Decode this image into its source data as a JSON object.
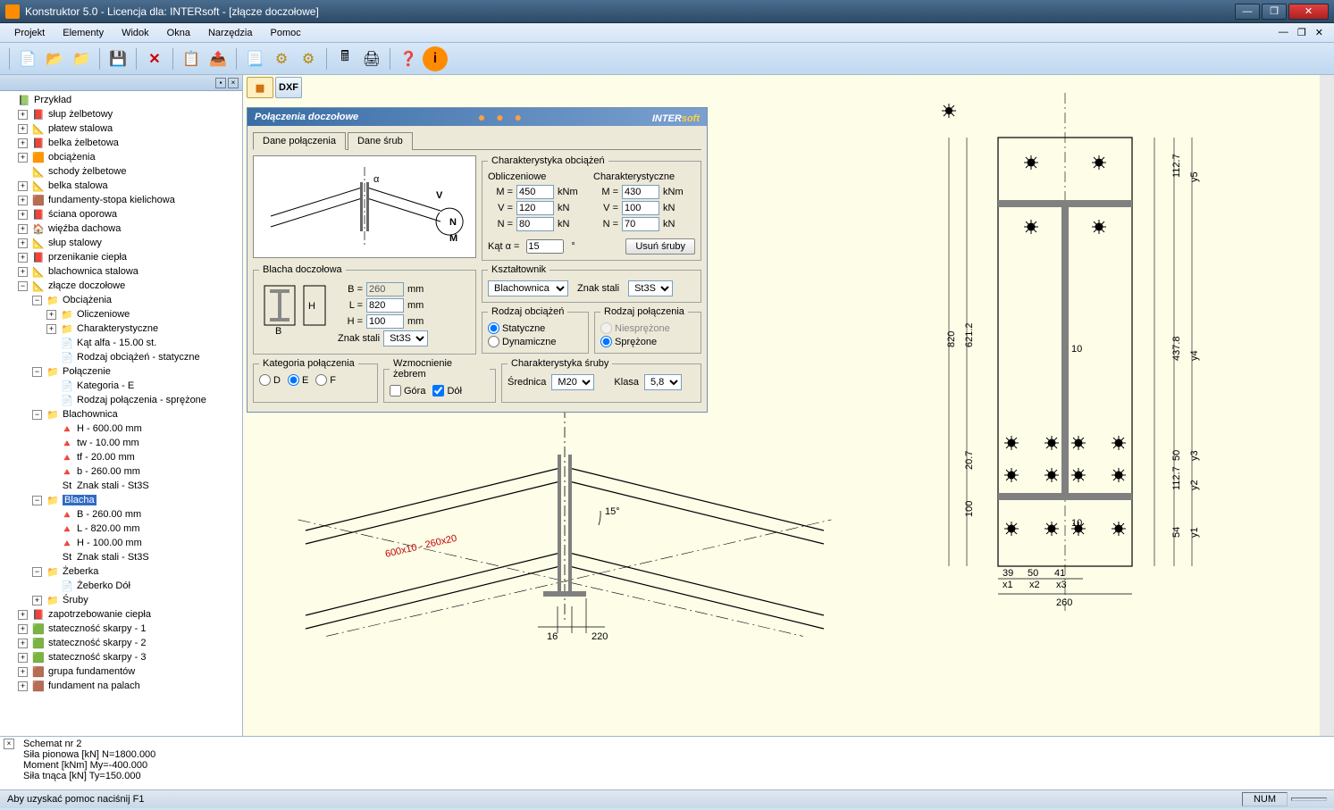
{
  "window": {
    "title": "Konstruktor 5.0 - Licencja dla: INTERsoft - [złącze doczołowe]"
  },
  "menus": [
    "Projekt",
    "Elementy",
    "Widok",
    "Okna",
    "Narzędzia",
    "Pomoc"
  ],
  "tree": {
    "root": "Przykład",
    "items": [
      {
        "d": 1,
        "exp": "+",
        "icon": "📕",
        "label": "słup żelbetowy"
      },
      {
        "d": 1,
        "exp": "+",
        "icon": "📐",
        "label": "płatew stalowa"
      },
      {
        "d": 1,
        "exp": "+",
        "icon": "📕",
        "label": "belka żelbetowa"
      },
      {
        "d": 1,
        "exp": "+",
        "icon": "🟧",
        "label": "obciążenia"
      },
      {
        "d": 1,
        "exp": "",
        "icon": "📐",
        "label": "schody żelbetowe"
      },
      {
        "d": 1,
        "exp": "+",
        "icon": "📐",
        "label": "belka stalowa"
      },
      {
        "d": 1,
        "exp": "+",
        "icon": "🟫",
        "label": "fundamenty-stopa kielichowa"
      },
      {
        "d": 1,
        "exp": "+",
        "icon": "📕",
        "label": "ściana oporowa"
      },
      {
        "d": 1,
        "exp": "+",
        "icon": "🏠",
        "label": "więźba dachowa"
      },
      {
        "d": 1,
        "exp": "+",
        "icon": "📐",
        "label": "słup stalowy"
      },
      {
        "d": 1,
        "exp": "+",
        "icon": "📕",
        "label": "przenikanie ciepła"
      },
      {
        "d": 1,
        "exp": "+",
        "icon": "📐",
        "label": "blachownica stalowa"
      },
      {
        "d": 1,
        "exp": "−",
        "icon": "📐",
        "label": "złącze doczołowe"
      },
      {
        "d": 2,
        "exp": "−",
        "icon": "📁",
        "label": "Obciążenia"
      },
      {
        "d": 3,
        "exp": "+",
        "icon": "📁",
        "label": "Oliczeniowe"
      },
      {
        "d": 3,
        "exp": "+",
        "icon": "📁",
        "label": "Charakterystyczne"
      },
      {
        "d": 3,
        "exp": "",
        "icon": "📄",
        "label": "Kąt alfa - 15.00 st."
      },
      {
        "d": 3,
        "exp": "",
        "icon": "📄",
        "label": "Rodzaj obciążeń - statyczne"
      },
      {
        "d": 2,
        "exp": "−",
        "icon": "📁",
        "label": "Połączenie"
      },
      {
        "d": 3,
        "exp": "",
        "icon": "📄",
        "label": "Kategoria - E"
      },
      {
        "d": 3,
        "exp": "",
        "icon": "📄",
        "label": "Rodzaj połączenia - sprężone"
      },
      {
        "d": 2,
        "exp": "−",
        "icon": "📁",
        "label": "Blachownica"
      },
      {
        "d": 3,
        "exp": "",
        "icon": "🔺",
        "label": "H - 600.00 mm"
      },
      {
        "d": 3,
        "exp": "",
        "icon": "🔺",
        "label": "tw - 10.00 mm"
      },
      {
        "d": 3,
        "exp": "",
        "icon": "🔺",
        "label": "tf - 20.00 mm"
      },
      {
        "d": 3,
        "exp": "",
        "icon": "🔺",
        "label": "b - 260.00 mm"
      },
      {
        "d": 3,
        "exp": "",
        "icon": "St",
        "label": "Znak stali - St3S"
      },
      {
        "d": 2,
        "exp": "−",
        "icon": "📁",
        "label": "Blacha",
        "selected": true
      },
      {
        "d": 3,
        "exp": "",
        "icon": "🔺",
        "label": "B - 260.00 mm"
      },
      {
        "d": 3,
        "exp": "",
        "icon": "🔺",
        "label": "L - 820.00 mm"
      },
      {
        "d": 3,
        "exp": "",
        "icon": "🔺",
        "label": "H - 100.00 mm"
      },
      {
        "d": 3,
        "exp": "",
        "icon": "St",
        "label": "Znak stali - St3S"
      },
      {
        "d": 2,
        "exp": "−",
        "icon": "📁",
        "label": "Żeberka"
      },
      {
        "d": 3,
        "exp": "",
        "icon": "📄",
        "label": "Żeberko Dół"
      },
      {
        "d": 2,
        "exp": "+",
        "icon": "📁",
        "label": "Śruby"
      },
      {
        "d": 1,
        "exp": "+",
        "icon": "📕",
        "label": "zapotrzebowanie ciepła"
      },
      {
        "d": 1,
        "exp": "+",
        "icon": "🟩",
        "label": "stateczność skarpy - 1"
      },
      {
        "d": 1,
        "exp": "+",
        "icon": "🟩",
        "label": "stateczność skarpy - 2"
      },
      {
        "d": 1,
        "exp": "+",
        "icon": "🟩",
        "label": "stateczność skarpy - 3"
      },
      {
        "d": 1,
        "exp": "+",
        "icon": "🟫",
        "label": "grupa fundamentów"
      },
      {
        "d": 1,
        "exp": "+",
        "icon": "🟫",
        "label": "fundament na palach"
      }
    ]
  },
  "canvas_tabs": {
    "view": "▦",
    "dxf": "DXF"
  },
  "dialog": {
    "title": "Połączenia doczołowe",
    "brand1": "INTER",
    "brand2": "soft",
    "tabs": [
      "Dane połączenia",
      "Dane śrub"
    ],
    "char_obc": "Charakterystyka obciążeń",
    "obliczeniowe": "Obliczeniowe",
    "charakterystyczne": "Charakterystyczne",
    "M_o": "450",
    "V_o": "120",
    "N_o": "80",
    "M_c": "430",
    "V_c": "100",
    "N_c": "70",
    "kat_label": "Kąt  α =",
    "kat": "15",
    "usun": "Usuń śruby",
    "blacha_title": "Blacha doczołowa",
    "B": "260",
    "L": "820",
    "H": "100",
    "znak_stali_label": "Znak stali",
    "znak_stali": "St3S",
    "ksztaltownik_title": "Kształtownik",
    "ksztaltownik": "Blachownica",
    "znak_stali2": "St3S",
    "rodzaj_obc_title": "Rodzaj obciążeń",
    "statyczne": "Statyczne",
    "dynamiczne": "Dynamiczne",
    "rodzaj_pol_title": "Rodzaj połączenia",
    "niesprezone": "Niesprężone",
    "sprezone": "Sprężone",
    "kategoria_title": "Kategoria połączenia",
    "kat_D": "D",
    "kat_E": "E",
    "kat_F": "F",
    "wzm_title": "Wzmocnienie żebrem",
    "gora": "Góra",
    "dol": "Dół",
    "char_sruby_title": "Charakterystyka śruby",
    "srednica_label": "Średnica",
    "srednica": "M20",
    "klasa_label": "Klasa",
    "klasa": "5,8"
  },
  "drawing": {
    "angle": "15°",
    "profile_text": "600x10 - 260x20",
    "dim_16": "16",
    "dim_220": "220",
    "dim_820": "820",
    "dim_260": "260",
    "dim_621": "621.2",
    "dim_437": "437.8",
    "dim_112a": "112.7",
    "dim_112b": "112.7",
    "dim_100": "100",
    "dim_20_7": "20.7",
    "dim_50": "50",
    "dim_54": "54",
    "dim_10a": "10",
    "dim_10b": "10",
    "dim_39": "39",
    "dim_50b": "50",
    "dim_41": "41",
    "x1": "x1",
    "x2": "x2",
    "x3": "x3",
    "y1": "y1",
    "y2": "y2",
    "y3": "y3",
    "y4": "y4",
    "y5": "y5"
  },
  "output": {
    "l1": "Schemat nr 2",
    "l2": "Siła pionowa [kN] N=1800.000",
    "l3": "Moment [kNm] My=-400.000",
    "l4": "Siła tnąca [kN] Ty=150.000"
  },
  "status": {
    "msg": "Aby uzyskać pomoc naciśnij F1",
    "num": "NUM"
  }
}
